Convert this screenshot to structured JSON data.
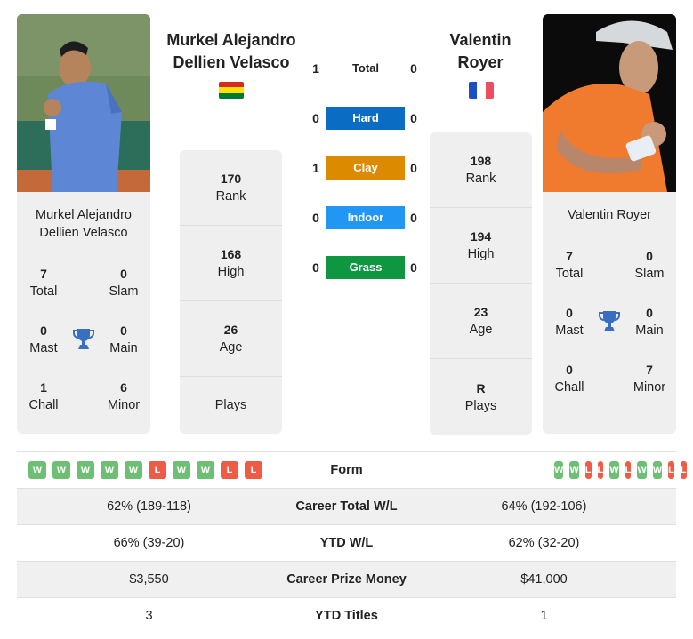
{
  "players": {
    "left": {
      "name": "Murkel Alejandro Dellien Velasco",
      "name_line1": "Murkel Alejandro",
      "name_line2": "Dellien Velasco",
      "country_flag": "bolivia-flag",
      "flag_colors": [
        "#d52b1e",
        "#f9e300",
        "#007934"
      ],
      "titles": {
        "total": {
          "value": "7",
          "label": "Total"
        },
        "slam": {
          "value": "0",
          "label": "Slam"
        },
        "mast": {
          "value": "0",
          "label": "Mast"
        },
        "main": {
          "value": "0",
          "label": "Main"
        },
        "chall": {
          "value": "1",
          "label": "Chall"
        },
        "minor": {
          "value": "6",
          "label": "Minor"
        }
      },
      "stats": {
        "rank": {
          "value": "170",
          "label": "Rank"
        },
        "high": {
          "value": "168",
          "label": "High"
        },
        "age": {
          "value": "26",
          "label": "Age"
        },
        "plays": {
          "value": "",
          "label": "Plays"
        }
      },
      "form": [
        "W",
        "W",
        "W",
        "W",
        "W",
        "L",
        "W",
        "W",
        "L",
        "L"
      ]
    },
    "right": {
      "name": "Valentin Royer",
      "name_line1": "Valentin",
      "name_line2": "Royer",
      "country_flag": "france-flag",
      "flag_colors": [
        "#0055a4",
        "#ffffff",
        "#ef4135"
      ],
      "titles": {
        "total": {
          "value": "7",
          "label": "Total"
        },
        "slam": {
          "value": "0",
          "label": "Slam"
        },
        "mast": {
          "value": "0",
          "label": "Mast"
        },
        "main": {
          "value": "0",
          "label": "Main"
        },
        "chall": {
          "value": "0",
          "label": "Chall"
        },
        "minor": {
          "value": "7",
          "label": "Minor"
        }
      },
      "stats": {
        "rank": {
          "value": "198",
          "label": "Rank"
        },
        "high": {
          "value": "194",
          "label": "High"
        },
        "age": {
          "value": "23",
          "label": "Age"
        },
        "plays": {
          "value": "R",
          "label": "Plays"
        }
      },
      "form": [
        "W",
        "W",
        "L",
        "L",
        "W",
        "L",
        "W",
        "W",
        "L",
        "L"
      ]
    }
  },
  "h2h": {
    "total": {
      "label": "Total",
      "left": "1",
      "right": "0"
    },
    "surfaces": [
      {
        "label": "Hard",
        "left": "0",
        "right": "0",
        "color": "#0b6cc4"
      },
      {
        "label": "Clay",
        "left": "1",
        "right": "0",
        "color": "#dc8a00"
      },
      {
        "label": "Indoor",
        "left": "0",
        "right": "0",
        "color": "#2196f3"
      },
      {
        "label": "Grass",
        "left": "0",
        "right": "0",
        "color": "#0f9640"
      }
    ]
  },
  "form_colors": {
    "W": "#6dbf73",
    "L": "#ef5b45"
  },
  "comparison": {
    "form_label": "Form",
    "rows": [
      {
        "label": "Career Total W/L",
        "left": "62% (189-118)",
        "right": "64% (192-106)"
      },
      {
        "label": "YTD W/L",
        "left": "66% (39-20)",
        "right": "62% (32-20)"
      },
      {
        "label": "Career Prize Money",
        "left": "$3,550",
        "right": "$41,000"
      },
      {
        "label": "YTD Titles",
        "left": "3",
        "right": "1"
      }
    ]
  }
}
